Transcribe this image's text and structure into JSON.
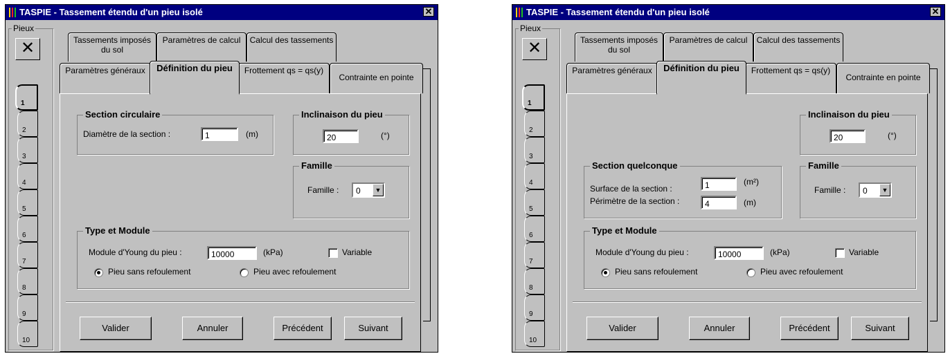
{
  "title": "TASPIE - Tassement étendu d'un pieu isolé",
  "close_glyph": "✕",
  "pieux_label": "Pieux",
  "delete_glyph": "✕",
  "pile_tabs": [
    "1",
    "2",
    "3",
    "4",
    "5",
    "6",
    "7",
    "8",
    "9",
    "10"
  ],
  "tabs_back": [
    "Tassements imposés du sol",
    "Paramètres de calcul",
    "Calcul des tassements"
  ],
  "tabs_front": [
    "Paramètres généraux",
    "Définition du pieu",
    "Frottement qs = qs(y)",
    "Contrainte en pointe"
  ],
  "active_tab": "Définition du pieu",
  "left": {
    "section": {
      "title": "Section circulaire",
      "diametre_label": "Diamètre de la section :",
      "diametre_value": "1",
      "diametre_unit": "(m)"
    },
    "inclinaison": {
      "title": "Inclinaison du pieu",
      "value": "20",
      "unit": "(°)"
    },
    "famille": {
      "title": "Famille",
      "label": "Famille :",
      "value": "0"
    },
    "type": {
      "title": "Type et Module",
      "module_label": "Module d'Young du pieu :",
      "module_value": "10000",
      "module_unit": "(kPa)",
      "variable_label": "Variable",
      "radio1": "Pieu sans refoulement",
      "radio2": "Pieu avec refoulement"
    }
  },
  "right": {
    "inclinaison": {
      "title": "Inclinaison du pieu",
      "value": "20",
      "unit": "(°)"
    },
    "section": {
      "title": "Section quelconque",
      "surface_label": "Surface de la section :",
      "surface_value": "1",
      "surface_unit": "(m²)",
      "perimetre_label": "Périmètre de la section :",
      "perimetre_value": "4",
      "perimetre_unit": "(m)"
    },
    "famille": {
      "title": "Famille",
      "label": "Famille :",
      "value": "0"
    },
    "type": {
      "title": "Type et Module",
      "module_label": "Module d'Young du pieu :",
      "module_value": "10000",
      "module_unit": "(kPa)",
      "variable_label": "Variable",
      "radio1": "Pieu sans refoulement",
      "radio2": "Pieu avec refoulement"
    }
  },
  "buttons": {
    "valider": "Valider",
    "annuler": "Annuler",
    "precedent": "Précédent",
    "suivant": "Suivant"
  },
  "colors": {
    "titlebar": "#000080",
    "face": "#c0c0c0"
  }
}
